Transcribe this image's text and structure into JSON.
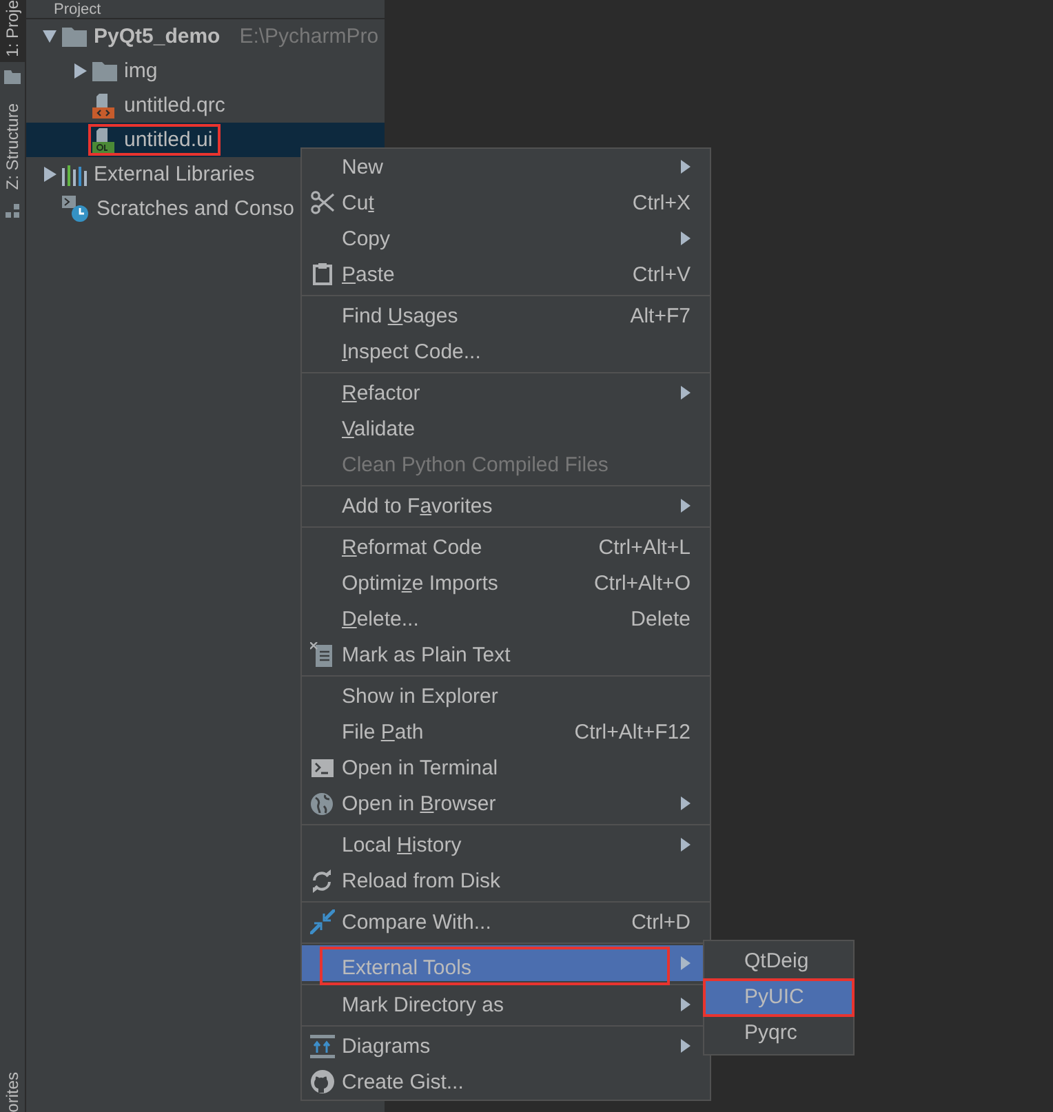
{
  "tool_stripe": {
    "top_tabs": [
      {
        "label": "1: Proje",
        "selected": true
      },
      {
        "label": "Z: Structure",
        "selected": false
      }
    ],
    "bottom_tabs": [
      {
        "label": "orites",
        "selected": false
      }
    ]
  },
  "project_panel": {
    "title": "Project",
    "tree": [
      {
        "kind": "folder",
        "label": "PyQt5_demo",
        "path": "E:\\PycharmPro",
        "expanded": true,
        "selected": false,
        "highlighted": false,
        "children": [
          {
            "kind": "folder",
            "label": "img",
            "expanded": false,
            "selected": false,
            "highlighted": false
          },
          {
            "kind": "qrc-file",
            "label": "untitled.qrc",
            "selected": false,
            "highlighted": false
          },
          {
            "kind": "ui-file",
            "label": "untitled.ui",
            "selected": true,
            "highlighted": true
          }
        ]
      },
      {
        "kind": "library",
        "label": "External Libraries",
        "expanded": false,
        "selected": false,
        "highlighted": false
      },
      {
        "kind": "scratches",
        "label": "Scratches and Conso",
        "selected": false,
        "highlighted": false
      }
    ]
  },
  "context_menu": {
    "items": [
      {
        "kind": "item",
        "label": [
          {
            "text": "New",
            "underlined": false
          }
        ],
        "submenu": true,
        "disabled": false,
        "selected": false,
        "highlighted": false
      },
      {
        "kind": "item",
        "label": [
          {
            "text": "Cu",
            "underlined": false
          },
          {
            "text": "t",
            "underlined": true
          }
        ],
        "shortcut": "Ctrl+X",
        "submenu": false,
        "disabled": false,
        "selected": false,
        "highlighted": false
      },
      {
        "kind": "item",
        "label": [
          {
            "text": "Copy",
            "underlined": false
          }
        ],
        "submenu": true,
        "disabled": false,
        "selected": false,
        "highlighted": false
      },
      {
        "kind": "item",
        "label": [
          {
            "text": "P",
            "underlined": true
          },
          {
            "text": "aste",
            "underlined": false
          }
        ],
        "shortcut": "Ctrl+V",
        "submenu": false,
        "disabled": false,
        "selected": false,
        "highlighted": false
      },
      {
        "kind": "separator"
      },
      {
        "kind": "item",
        "label": [
          {
            "text": "Find ",
            "underlined": false
          },
          {
            "text": "U",
            "underlined": true
          },
          {
            "text": "sages",
            "underlined": false
          }
        ],
        "shortcut": "Alt+F7",
        "submenu": false,
        "disabled": false,
        "selected": false,
        "highlighted": false
      },
      {
        "kind": "item",
        "label": [
          {
            "text": "I",
            "underlined": true
          },
          {
            "text": "nspect Code...",
            "underlined": false
          }
        ],
        "submenu": false,
        "disabled": false,
        "selected": false,
        "highlighted": false
      },
      {
        "kind": "separator"
      },
      {
        "kind": "item",
        "label": [
          {
            "text": "R",
            "underlined": true
          },
          {
            "text": "efactor",
            "underlined": false
          }
        ],
        "submenu": true,
        "disabled": false,
        "selected": false,
        "highlighted": false
      },
      {
        "kind": "item",
        "label": [
          {
            "text": "V",
            "underlined": true
          },
          {
            "text": "alidate",
            "underlined": false
          }
        ],
        "submenu": false,
        "disabled": false,
        "selected": false,
        "highlighted": false
      },
      {
        "kind": "item",
        "label": [
          {
            "text": "Clean Python Compiled Files",
            "underlined": false
          }
        ],
        "submenu": false,
        "disabled": true,
        "selected": false,
        "highlighted": false
      },
      {
        "kind": "separator"
      },
      {
        "kind": "item",
        "label": [
          {
            "text": "Add to F",
            "underlined": false
          },
          {
            "text": "a",
            "underlined": true
          },
          {
            "text": "vorites",
            "underlined": false
          }
        ],
        "submenu": true,
        "disabled": false,
        "selected": false,
        "highlighted": false
      },
      {
        "kind": "separator"
      },
      {
        "kind": "item",
        "label": [
          {
            "text": "R",
            "underlined": true
          },
          {
            "text": "eformat Code",
            "underlined": false
          }
        ],
        "shortcut": "Ctrl+Alt+L",
        "submenu": false,
        "disabled": false,
        "selected": false,
        "highlighted": false
      },
      {
        "kind": "item",
        "label": [
          {
            "text": "Optimi",
            "underlined": false
          },
          {
            "text": "z",
            "underlined": true
          },
          {
            "text": "e Imports",
            "underlined": false
          }
        ],
        "shortcut": "Ctrl+Alt+O",
        "submenu": false,
        "disabled": false,
        "selected": false,
        "highlighted": false
      },
      {
        "kind": "item",
        "label": [
          {
            "text": "D",
            "underlined": true
          },
          {
            "text": "elete...",
            "underlined": false
          }
        ],
        "shortcut": "Delete",
        "submenu": false,
        "disabled": false,
        "selected": false,
        "highlighted": false
      },
      {
        "kind": "item",
        "label": [
          {
            "text": "Mark as Plain Text",
            "underlined": false
          }
        ],
        "submenu": false,
        "disabled": false,
        "selected": false,
        "highlighted": false
      },
      {
        "kind": "separator"
      },
      {
        "kind": "item",
        "label": [
          {
            "text": "Show in Explorer",
            "underlined": false
          }
        ],
        "submenu": false,
        "disabled": false,
        "selected": false,
        "highlighted": false
      },
      {
        "kind": "item",
        "label": [
          {
            "text": "File ",
            "underlined": false
          },
          {
            "text": "P",
            "underlined": true
          },
          {
            "text": "ath",
            "underlined": false
          }
        ],
        "shortcut": "Ctrl+Alt+F12",
        "submenu": false,
        "disabled": false,
        "selected": false,
        "highlighted": false
      },
      {
        "kind": "item",
        "label": [
          {
            "text": "Open in Terminal",
            "underlined": false
          }
        ],
        "submenu": false,
        "disabled": false,
        "selected": false,
        "highlighted": false
      },
      {
        "kind": "item",
        "label": [
          {
            "text": "Open in ",
            "underlined": false
          },
          {
            "text": "B",
            "underlined": true
          },
          {
            "text": "rowser",
            "underlined": false
          }
        ],
        "submenu": true,
        "disabled": false,
        "selected": false,
        "highlighted": false
      },
      {
        "kind": "separator"
      },
      {
        "kind": "item",
        "label": [
          {
            "text": "Local ",
            "underlined": false
          },
          {
            "text": "H",
            "underlined": true
          },
          {
            "text": "istory",
            "underlined": false
          }
        ],
        "submenu": true,
        "disabled": false,
        "selected": false,
        "highlighted": false
      },
      {
        "kind": "item",
        "label": [
          {
            "text": "Reload from Disk",
            "underlined": false
          }
        ],
        "submenu": false,
        "disabled": false,
        "selected": false,
        "highlighted": false
      },
      {
        "kind": "separator"
      },
      {
        "kind": "item",
        "label": [
          {
            "text": "Compare With...",
            "underlined": false
          }
        ],
        "shortcut": "Ctrl+D",
        "submenu": false,
        "disabled": false,
        "selected": false,
        "highlighted": false
      },
      {
        "kind": "separator"
      },
      {
        "kind": "item",
        "label": [
          {
            "text": "External Tools",
            "underlined": false
          }
        ],
        "submenu": true,
        "disabled": false,
        "selected": true,
        "highlighted": true,
        "items": [
          {
            "label": "QtDeig",
            "selected": false,
            "highlighted": false
          },
          {
            "label": "PyUIC",
            "selected": true,
            "highlighted": true
          },
          {
            "label": "Pyqrc",
            "selected": false,
            "highlighted": false
          }
        ]
      },
      {
        "kind": "separator"
      },
      {
        "kind": "item",
        "label": [
          {
            "text": "Mark Directory as",
            "underlined": false
          }
        ],
        "submenu": true,
        "disabled": false,
        "selected": false,
        "highlighted": false
      },
      {
        "kind": "separator"
      },
      {
        "kind": "item",
        "label": [
          {
            "text": "Diagrams",
            "underlined": false
          }
        ],
        "submenu": true,
        "disabled": false,
        "selected": false,
        "highlighted": false
      },
      {
        "kind": "item",
        "label": [
          {
            "text": "Create Gist...",
            "underlined": false
          }
        ],
        "submenu": false,
        "disabled": false,
        "selected": false,
        "highlighted": false
      }
    ]
  }
}
